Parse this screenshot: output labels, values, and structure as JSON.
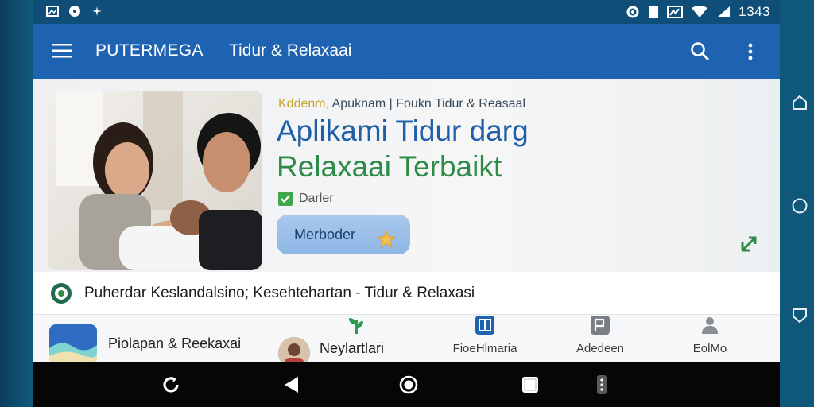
{
  "status_bar": {
    "time": "1343"
  },
  "app_bar": {
    "app_name": "PUTERMEGA",
    "title": "Tidur & Relaxaai"
  },
  "hero": {
    "kicker_prefix": "Kddenm, ",
    "kicker_rest": "Apuknam | Foukn Tidur & Reasaal",
    "title_line1": "Aplikami Tidur darg",
    "title_line2": "Relaxaai Terbaikt",
    "check_label": "Darler",
    "cta_label": "Merboder"
  },
  "info_row": {
    "text": "Puherdar Keslandalsino; Kesehtehartan - Tidur & Relaxasi"
  },
  "list": {
    "item_label": "Piolapan & Reekaxai",
    "profile_name": "Neylartlari"
  },
  "bottom_nav": [
    {
      "label": "",
      "icon": "sprout-icon"
    },
    {
      "label": "FioeHlmaria",
      "icon": "book-icon"
    },
    {
      "label": "Adedeen",
      "icon": "document-icon"
    },
    {
      "label": "EolMo",
      "icon": "person-icon"
    }
  ],
  "colors": {
    "app_bar": "#1e63b1",
    "title_blue": "#1f5fa8",
    "title_green": "#2e8b47",
    "status_bar": "#0f4e78"
  }
}
